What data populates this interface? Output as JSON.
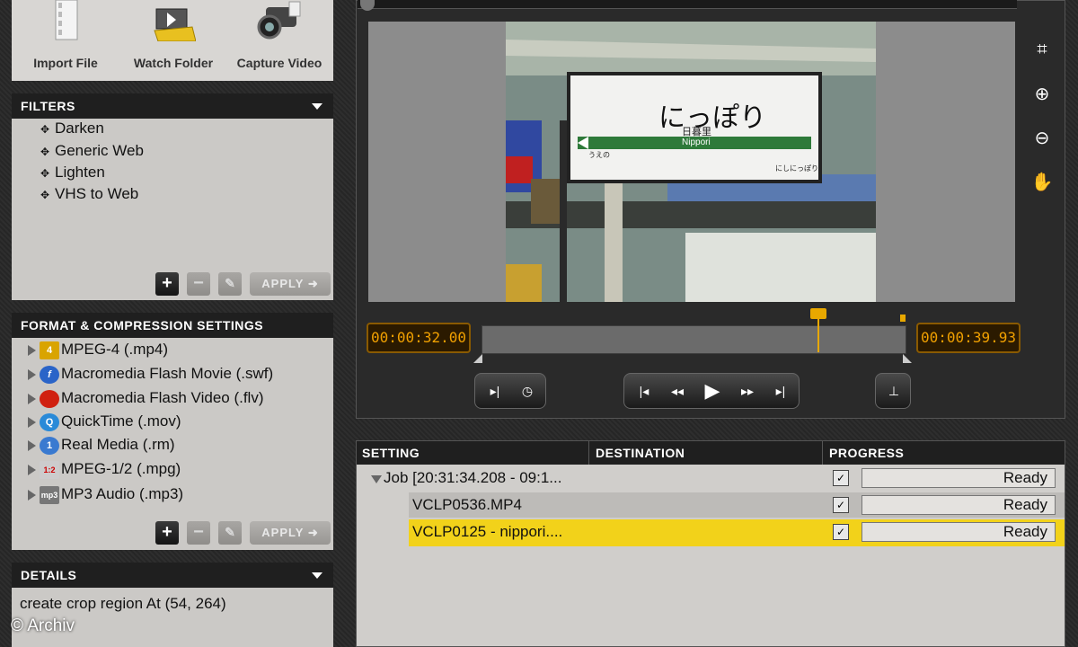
{
  "import_toolbar": {
    "tools": [
      {
        "label": "Import File",
        "icon": "import-file-icon"
      },
      {
        "label": "Watch Folder",
        "icon": "watch-folder-icon"
      },
      {
        "label": "Capture Video",
        "icon": "video-camera-icon"
      }
    ]
  },
  "filters": {
    "title": "FILTERS",
    "items": [
      "Darken",
      "Generic Web",
      "Lighten",
      "VHS to Web"
    ],
    "apply_label": "APPLY"
  },
  "formats": {
    "title": "FORMAT & COMPRESSION SETTINGS",
    "items": [
      {
        "label": "MPEG-4 (.mp4)",
        "icon": "mpeg4-icon",
        "icon_text": "4"
      },
      {
        "label": "Macromedia Flash Movie (.swf)",
        "icon": "flash-movie-icon",
        "icon_text": "f"
      },
      {
        "label": "Macromedia Flash Video (.flv)",
        "icon": "flash-video-icon",
        "icon_text": ""
      },
      {
        "label": "QuickTime (.mov)",
        "icon": "quicktime-icon",
        "icon_text": "Q"
      },
      {
        "label": "Real Media (.rm)",
        "icon": "real-media-icon",
        "icon_text": "1"
      },
      {
        "label": "MPEG-1/2 (.mpg)",
        "icon": "mpeg12-icon",
        "icon_text": "1:2"
      },
      {
        "label": "MP3 Audio (.mp3)",
        "icon": "mp3-icon",
        "icon_text": "mp3"
      }
    ],
    "apply_label": "APPLY"
  },
  "details": {
    "title": "DETAILS",
    "text": "create crop region At (54, 264)"
  },
  "player": {
    "in_time": "00:00:32.00",
    "out_time": "00:00:39.93",
    "sign_text": "にっぽり",
    "sign_kanji": "日暮里",
    "sign_romaji": "Nippori",
    "sign_left": "うえの",
    "sign_right": "にしにっぽり"
  },
  "queue": {
    "headers": {
      "setting": "SETTING",
      "destination": "DESTINATION",
      "progress": "PROGRESS"
    },
    "rows": [
      {
        "setting": "Job [20:31:34.208 - 09:1...",
        "status": "Ready"
      },
      {
        "setting": "VCLP0536.MP4",
        "status": "Ready"
      },
      {
        "setting": "VCLP0125 - nippori....",
        "status": "Ready"
      }
    ]
  },
  "watermark": "© Archiv",
  "colors": {
    "accent": "#f0a000",
    "highlight_row": "#f2d21a"
  }
}
